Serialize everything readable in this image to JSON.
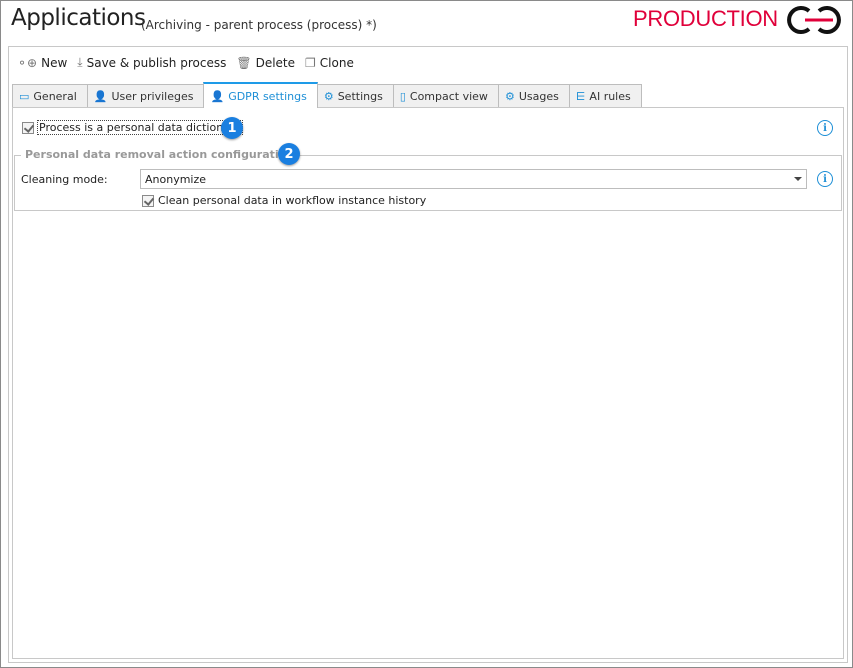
{
  "header": {
    "title": "Applications",
    "subtitle": "(Archiving - parent process (process) *)",
    "environment": "PRODUCTION",
    "env_color": "#e0003a"
  },
  "toolbar": {
    "new": "New",
    "save": "Save & publish process",
    "delete": "Delete",
    "clone": "Clone"
  },
  "tabs": [
    {
      "label": "General",
      "icon": "window-icon"
    },
    {
      "label": "User privileges",
      "icon": "user-lock-icon"
    },
    {
      "label": "GDPR settings",
      "icon": "user-shield-icon",
      "active": true
    },
    {
      "label": "Settings",
      "icon": "window-gear-icon"
    },
    {
      "label": "Compact view",
      "icon": "phone-icon"
    },
    {
      "label": "Usages",
      "icon": "gear-hand-icon"
    },
    {
      "label": "AI rules",
      "icon": "flow-icon"
    }
  ],
  "gdpr": {
    "personal_dict_label": "Process is a personal data dictionary",
    "personal_dict_checked": true,
    "badge1": "1",
    "group_title": "Personal data removal action configuration",
    "badge2": "2",
    "cleaning_mode_label": "Cleaning mode:",
    "cleaning_mode_value": "Anonymize",
    "clean_history_label": "Clean personal data in workflow instance history",
    "clean_history_checked": true
  },
  "colors": {
    "accent": "#1e9be8",
    "badge": "#1a7fe0"
  }
}
